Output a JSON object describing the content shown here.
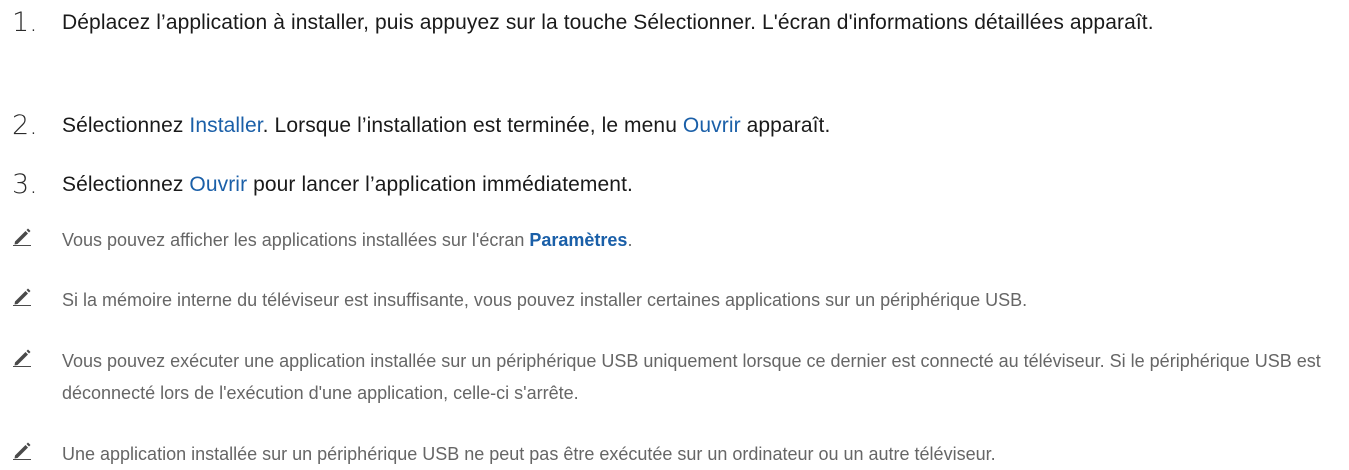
{
  "colors": {
    "text": "#1a1a1a",
    "note_text": "#666666",
    "link": "#1a5fa8"
  },
  "steps": [
    {
      "number": "1.",
      "text": "Déplacez l’application à installer, puis appuyez sur la touche Sélectionner. L'écran d'informations détaillées apparaît."
    },
    {
      "number": "2.",
      "text_a": "Sélectionnez ",
      "link_a": "Installer",
      "text_b": ". Lorsque l’installation est terminée, le menu ",
      "link_b": "Ouvrir",
      "text_c": " apparaît."
    },
    {
      "number": "3.",
      "text_a": "Sélectionnez ",
      "link_a": "Ouvrir",
      "text_b": " pour lancer l’application immédiatement."
    }
  ],
  "notes": [
    {
      "icon": "pencil-icon",
      "text_a": "Vous pouvez afficher les applications installées sur l'écran ",
      "link_a": "Paramètres",
      "text_b": "."
    },
    {
      "icon": "pencil-icon",
      "text": "Si la mémoire interne du téléviseur est insuffisante, vous pouvez installer certaines applications sur un périphérique USB."
    },
    {
      "icon": "pencil-icon",
      "text": "Vous pouvez exécuter une application installée sur un périphérique USB uniquement lorsque ce dernier est connecté au téléviseur. Si le périphérique USB est déconnecté lors de l'exécution d'une application, celle-ci s'arrête."
    },
    {
      "icon": "pencil-icon",
      "text": "Une application installée sur un périphérique USB ne peut pas être exécutée sur un ordinateur ou un autre téléviseur."
    }
  ]
}
